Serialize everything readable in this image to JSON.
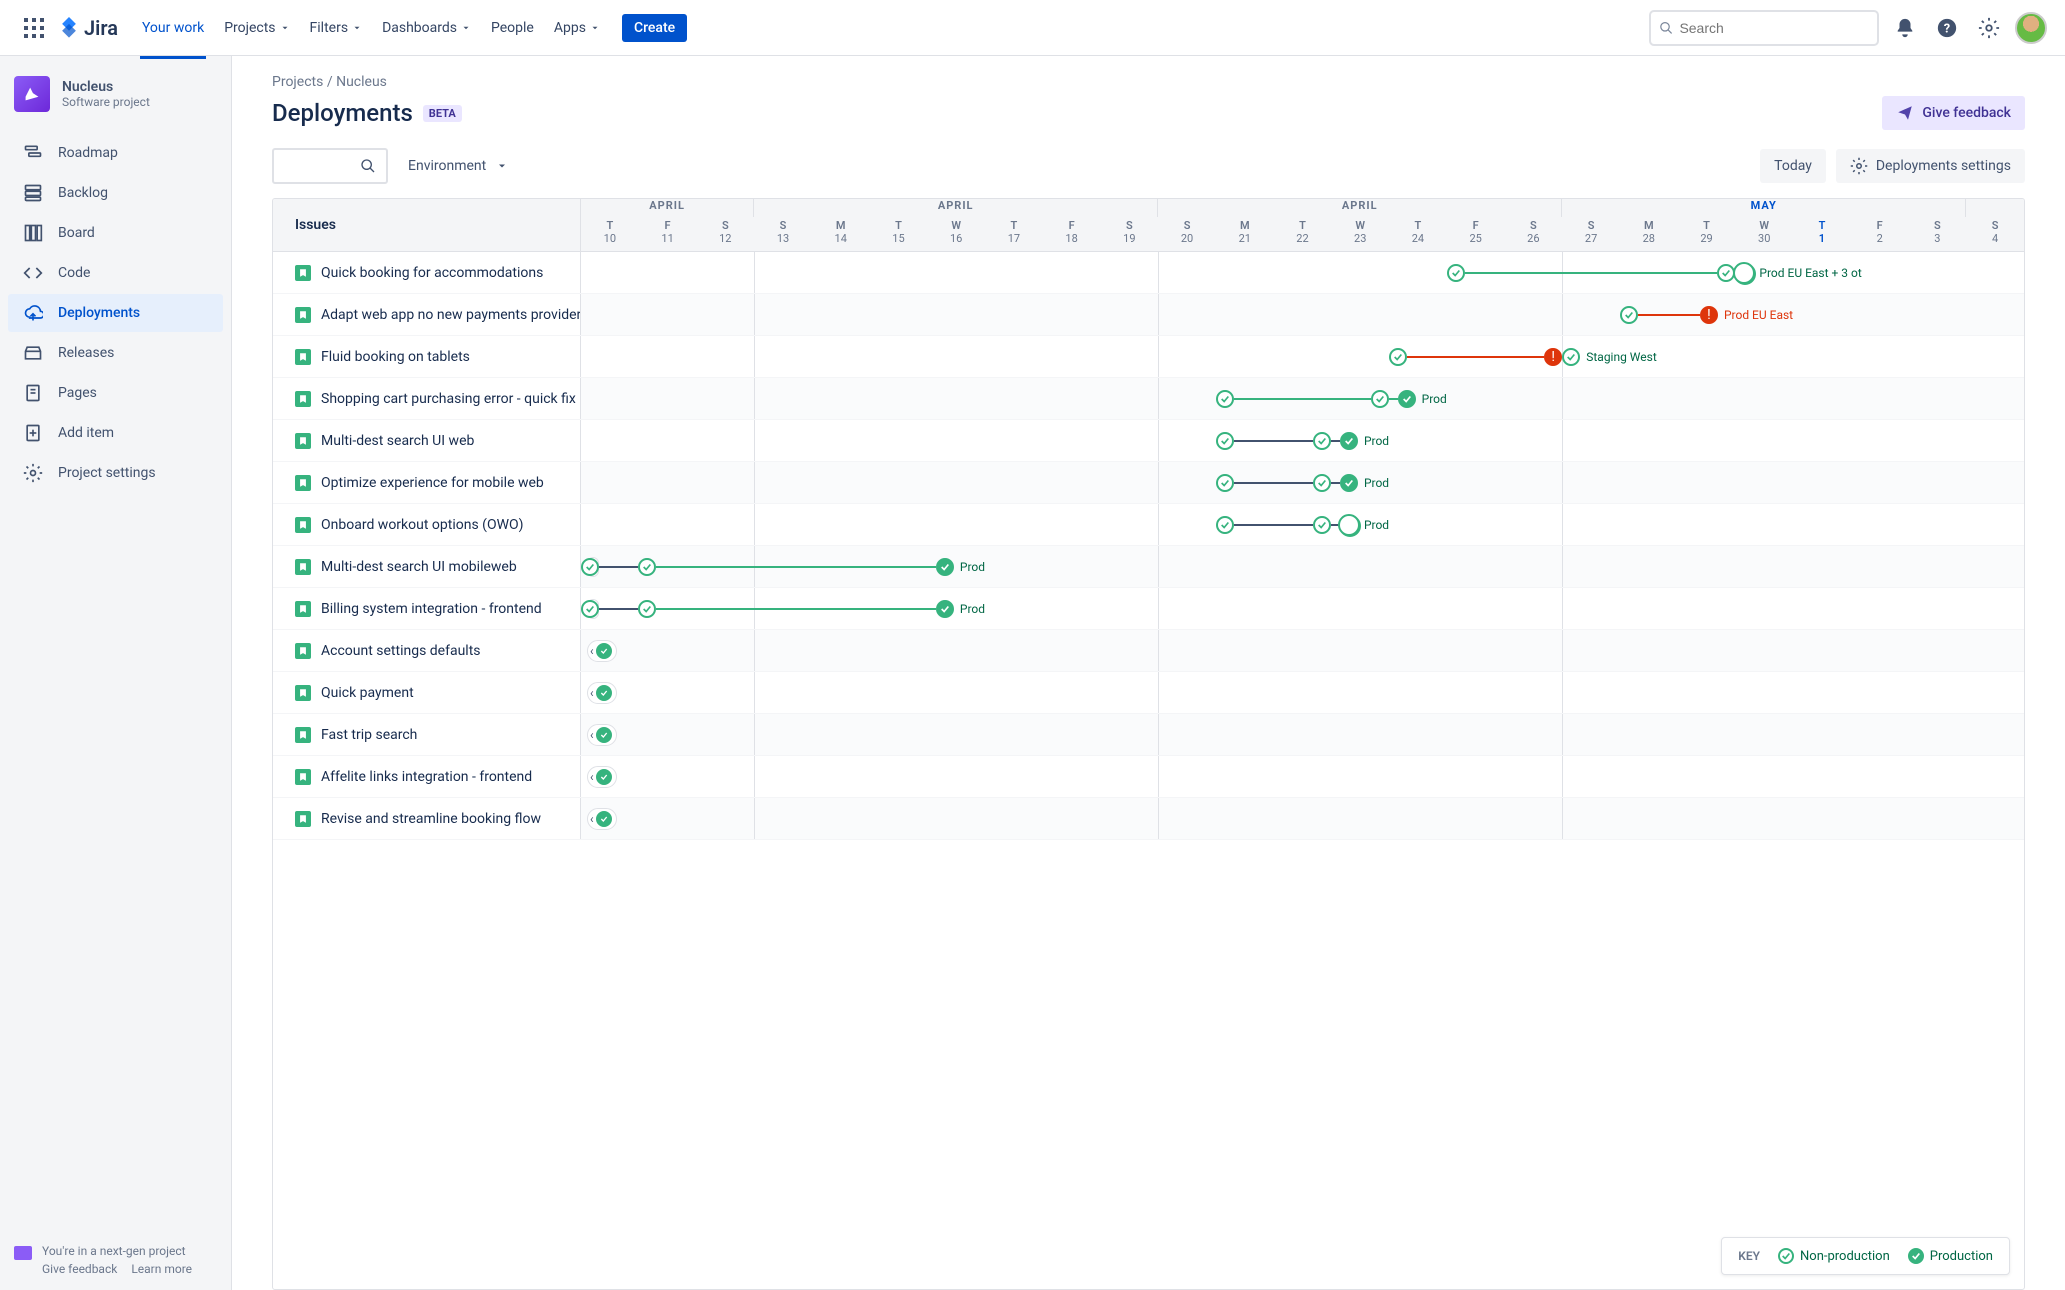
{
  "header": {
    "product": "Jira",
    "nav": [
      "Your work",
      "Projects",
      "Filters",
      "Dashboards",
      "People",
      "Apps"
    ],
    "active_nav": "Your work",
    "create": "Create",
    "search_placeholder": "Search"
  },
  "project": {
    "name": "Nucleus",
    "type": "Software project"
  },
  "sidebar": {
    "items": [
      {
        "label": "Roadmap",
        "icon": "roadmap"
      },
      {
        "label": "Backlog",
        "icon": "backlog"
      },
      {
        "label": "Board",
        "icon": "board"
      },
      {
        "label": "Code",
        "icon": "code"
      },
      {
        "label": "Deployments",
        "icon": "deployments",
        "selected": true
      },
      {
        "label": "Releases",
        "icon": "releases"
      },
      {
        "label": "Pages",
        "icon": "pages"
      },
      {
        "label": "Add item",
        "icon": "add"
      },
      {
        "label": "Project settings",
        "icon": "settings"
      }
    ],
    "footer": {
      "line": "You're in a next-gen project",
      "feedback": "Give feedback",
      "learn_more": "Learn more"
    }
  },
  "page": {
    "breadcrumb_1": "Projects",
    "breadcrumb_2": "Nucleus",
    "title": "Deployments",
    "badge": "BETA",
    "feedback_btn": "Give feedback",
    "environment": "Environment",
    "today": "Today",
    "settings": "Deployments settings",
    "issues_header": "Issues"
  },
  "timeline": {
    "groups": [
      {
        "label": "APRIL",
        "span": 3
      },
      {
        "label": "APRIL",
        "span": 7
      },
      {
        "label": "APRIL",
        "span": 7
      },
      {
        "label": "MAY",
        "span": 7,
        "current": true
      }
    ],
    "days": [
      {
        "dow": "T",
        "num": "10"
      },
      {
        "dow": "F",
        "num": "11"
      },
      {
        "dow": "S",
        "num": "12"
      },
      {
        "dow": "S",
        "num": "13"
      },
      {
        "dow": "M",
        "num": "14"
      },
      {
        "dow": "T",
        "num": "15"
      },
      {
        "dow": "W",
        "num": "16"
      },
      {
        "dow": "T",
        "num": "17"
      },
      {
        "dow": "F",
        "num": "18"
      },
      {
        "dow": "S",
        "num": "19"
      },
      {
        "dow": "S",
        "num": "20"
      },
      {
        "dow": "M",
        "num": "21"
      },
      {
        "dow": "T",
        "num": "22"
      },
      {
        "dow": "W",
        "num": "23"
      },
      {
        "dow": "T",
        "num": "24"
      },
      {
        "dow": "F",
        "num": "25"
      },
      {
        "dow": "S",
        "num": "26"
      },
      {
        "dow": "S",
        "num": "27"
      },
      {
        "dow": "M",
        "num": "28"
      },
      {
        "dow": "T",
        "num": "29"
      },
      {
        "dow": "W",
        "num": "30"
      },
      {
        "dow": "T",
        "num": "1",
        "current": true
      },
      {
        "dow": "F",
        "num": "2"
      },
      {
        "dow": "S",
        "num": "3"
      },
      {
        "dow": "S",
        "num": "4"
      }
    ],
    "rows": [
      {
        "title": "Quick booking for accommodations",
        "segments": [
          {
            "start": 15,
            "end": 20,
            "startNode": "ok",
            "endNode": "ok",
            "color": "green"
          },
          {
            "start": 20,
            "end": 21,
            "startNode": "",
            "endNode": "ok-fill-stack",
            "color": "green",
            "label": "Prod EU East + 3 ot",
            "labelColor": "green"
          }
        ]
      },
      {
        "title": "Adapt web app no new payments provider",
        "segments": [
          {
            "start": 18,
            "end": 21,
            "startNode": "ok",
            "endNode": "fail",
            "color": "red",
            "label": "Prod EU East",
            "labelColor": "red"
          }
        ]
      },
      {
        "title": "Fluid booking on tablets",
        "segments": [
          {
            "start": 14,
            "end": 17,
            "startNode": "ok",
            "endNode": "fail",
            "color": "red"
          },
          {
            "start": 17,
            "end": 18,
            "startNode": "",
            "endNode": "ok",
            "color": "black",
            "label": "Staging West",
            "labelColor": "green"
          }
        ]
      },
      {
        "title": "Shopping cart purchasing error - quick fix",
        "segments": [
          {
            "start": 11,
            "end": 14,
            "startNode": "ok",
            "endNode": "ok",
            "color": "green"
          },
          {
            "start": 14,
            "end": 15,
            "startNode": "",
            "endNode": "ok-fill",
            "color": "green",
            "label": "Prod",
            "labelColor": "green"
          }
        ]
      },
      {
        "title": "Multi-dest search UI web",
        "segments": [
          {
            "start": 11,
            "end": 13,
            "startNode": "ok",
            "endNode": "ok",
            "color": "black"
          },
          {
            "start": 13,
            "end": 14,
            "startNode": "",
            "endNode": "ok-fill",
            "color": "black",
            "label": "Prod",
            "labelColor": "green"
          }
        ]
      },
      {
        "title": "Optimize experience for mobile web",
        "segments": [
          {
            "start": 11,
            "end": 13,
            "startNode": "ok",
            "endNode": "ok",
            "color": "black"
          },
          {
            "start": 13,
            "end": 14,
            "startNode": "",
            "endNode": "ok-fill",
            "color": "black",
            "label": "Prod",
            "labelColor": "green"
          }
        ]
      },
      {
        "title": "Onboard workout options (OWO)",
        "segments": [
          {
            "start": 11,
            "end": 13,
            "startNode": "ok",
            "endNode": "ok",
            "color": "black"
          },
          {
            "start": 13,
            "end": 14,
            "startNode": "",
            "endNode": "ok-fill-stack",
            "color": "black",
            "label": "Prod",
            "labelColor": "green"
          }
        ]
      },
      {
        "title": "Multi-dest search UI mobileweb",
        "chev": true,
        "segments": [
          {
            "start": 0,
            "end": 1.3,
            "startNode": "ok",
            "endNode": "ok",
            "color": "black"
          },
          {
            "start": 1.3,
            "end": 7,
            "startNode": "",
            "endNode": "ok-fill",
            "color": "green",
            "label": "Prod",
            "labelColor": "green"
          }
        ]
      },
      {
        "title": "Billing system integration - frontend",
        "chev": true,
        "segments": [
          {
            "start": 0,
            "end": 1.3,
            "startNode": "ok",
            "endNode": "ok",
            "color": "black"
          },
          {
            "start": 1.3,
            "end": 7,
            "startNode": "",
            "endNode": "ok-fill",
            "color": "green",
            "label": "Prod",
            "labelColor": "green"
          }
        ]
      },
      {
        "title": "Account settings defaults",
        "chev": true,
        "chevOnly": true
      },
      {
        "title": "Quick payment",
        "chev": true,
        "chevOnly": true
      },
      {
        "title": "Fast trip search",
        "chev": true,
        "chevOnly": true
      },
      {
        "title": "Affelite links integration - frontend",
        "chev": true,
        "chevOnly": true
      },
      {
        "title": "Revise and streamline booking flow",
        "chev": true,
        "chevOnly": true
      }
    ]
  },
  "legend": {
    "key": "KEY",
    "nonprod": "Non-production",
    "prod": "Production"
  }
}
